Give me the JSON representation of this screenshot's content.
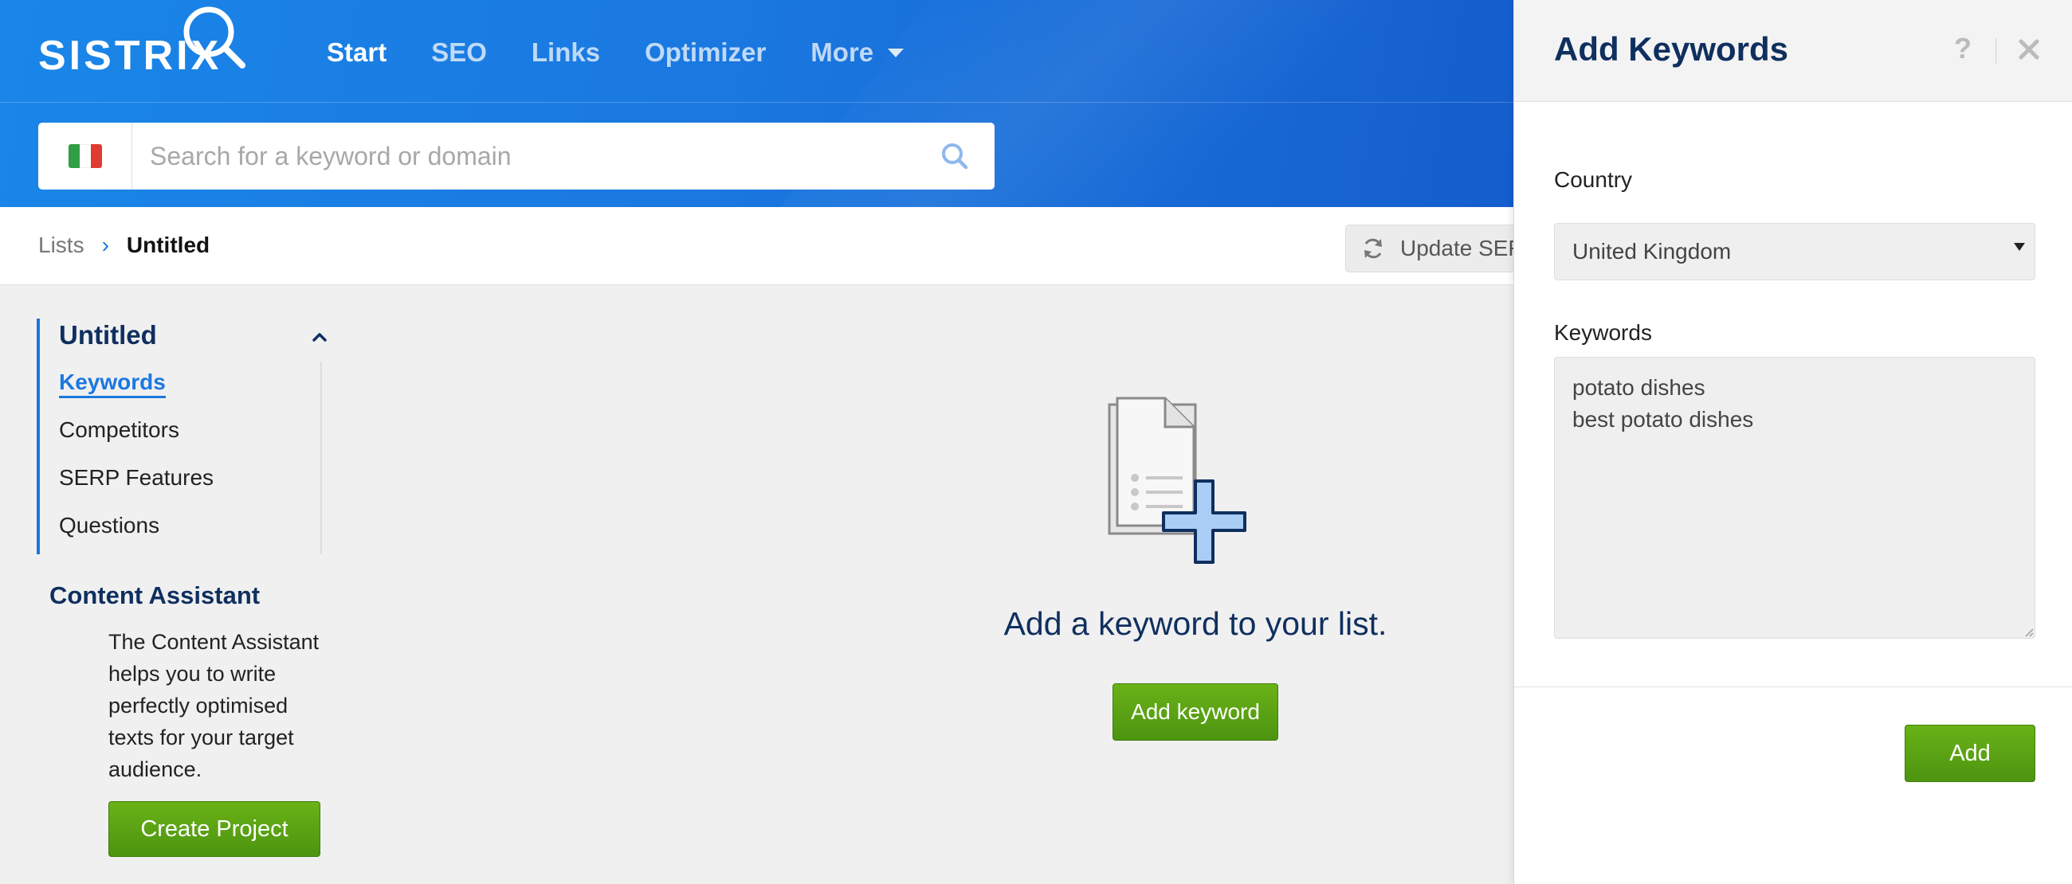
{
  "header": {
    "logo_text": "SISTRIX",
    "nav": [
      {
        "label": "Start"
      },
      {
        "label": "SEO"
      },
      {
        "label": "Links"
      },
      {
        "label": "Optimizer"
      },
      {
        "label": "More"
      }
    ],
    "search": {
      "placeholder": "Search for a keyword or domain",
      "value": ""
    }
  },
  "breadcrumb": {
    "parent": "Lists",
    "current": "Untitled",
    "update_label": "Update SER"
  },
  "sidebar": {
    "title": "Untitled",
    "items": [
      {
        "label": "Keywords"
      },
      {
        "label": "Competitors"
      },
      {
        "label": "SERP Features"
      },
      {
        "label": "Questions"
      }
    ],
    "content_assistant": {
      "title": "Content Assistant",
      "text": "The Content Assistant helps you to write perfectly optimised texts for your target audience.",
      "button": "Create Project"
    }
  },
  "empty_state": {
    "title": "Add a keyword to your list.",
    "button": "Add keyword"
  },
  "panel": {
    "title": "Add Keywords",
    "help_symbol": "?",
    "country_label": "Country",
    "country_value": "United Kingdom",
    "keywords_label": "Keywords",
    "keywords_value": "potato dishes\nbest potato dishes",
    "add_button": "Add"
  },
  "colors": {
    "header_blue": "#1a78e0",
    "accent_blue": "#1a78e0",
    "navy_text": "#0f2f5f",
    "green_button": "#5aa314",
    "flag_green": "#2f9e44",
    "flag_white": "#ffffff",
    "flag_red": "#e03c31"
  }
}
